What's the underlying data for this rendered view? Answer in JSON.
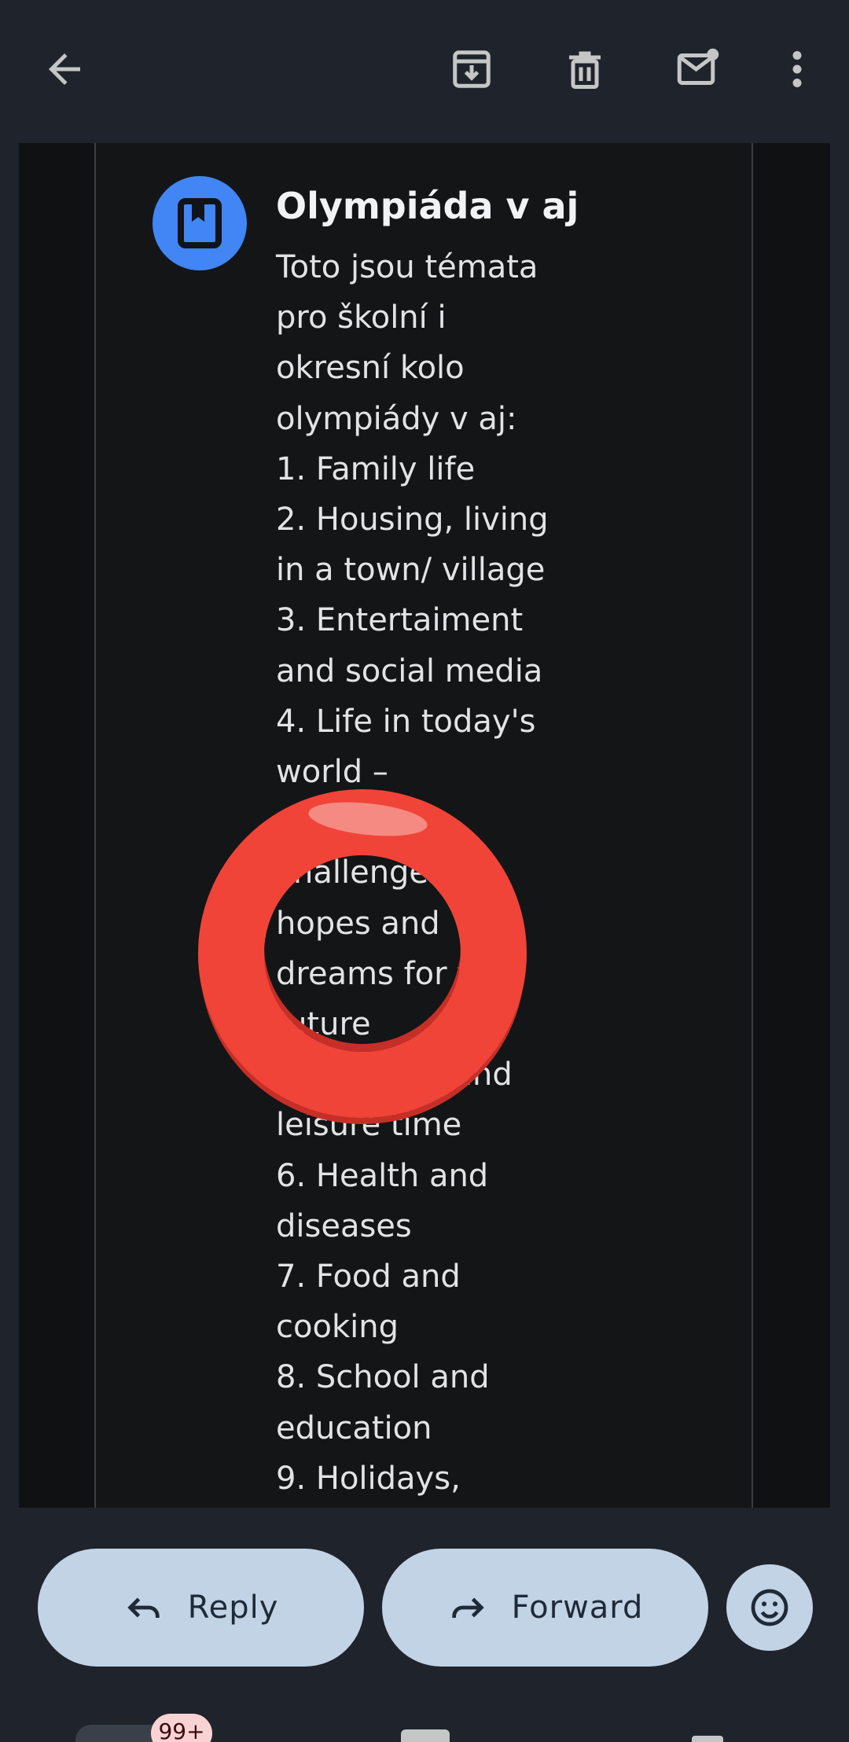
{
  "toolbar": {
    "back_icon": "arrow-left-icon",
    "archive_icon": "archive-icon",
    "delete_icon": "trash-icon",
    "mark_unread_icon": "mail-unread-icon",
    "more_icon": "more-vert-icon"
  },
  "post": {
    "title": "Olympiáda v aj",
    "avatar_icon": "bookmark-icon",
    "avatar_color": "#4285f4",
    "body": "Toto jsou témata\npro školní i\nokresní kolo\nolympiády v aj:\n1. Family life\n2. Housing, living\nin a town/ village\n3. Entertaiment\nand social media\n4. Life in today's\nworld –\n\nchallenges,\nhopes and\ndreams for the\nfuture\n5. Hobbies and\nleisure time\n6. Health and\ndiseases\n7. Food and\ncooking\n8. School and\neducation\n9. Holidays,"
  },
  "actions": {
    "reply_label": "Reply",
    "forward_label": "Forward",
    "emoji_icon": "emoji-smile-icon"
  },
  "nav": {
    "mail_badge": "99+"
  },
  "colors": {
    "ring": "#f04438",
    "pill": "#c2d3e6"
  }
}
